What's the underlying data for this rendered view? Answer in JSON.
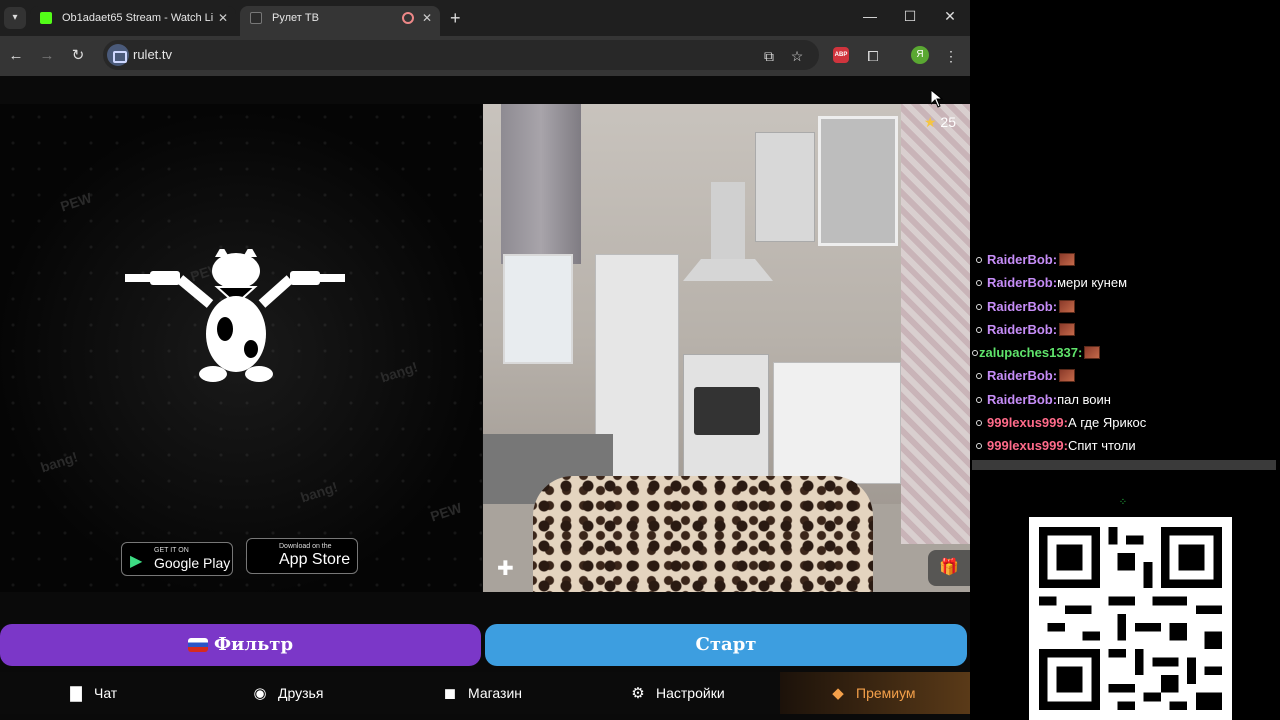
{
  "browser": {
    "tabs": [
      {
        "title": "Ob1adaet65 Stream - Watch Li",
        "favicon_color": "#53fc18"
      },
      {
        "title": "Рулет ТВ",
        "favicon_color": "#2b2b2b"
      }
    ],
    "url": "rulet.tv",
    "profile_initial": "Я",
    "abp_label": "ABP"
  },
  "page": {
    "store_buttons": {
      "google_small": "GET IT ON",
      "google_big": "Google Play",
      "apple_small": "Download on the",
      "apple_big": "App Store"
    },
    "video": {
      "stars": "25"
    },
    "filter_label": "Фильтр",
    "start_label": "Старт",
    "nav": [
      {
        "label": "Чат",
        "icon": "chat-icon"
      },
      {
        "label": "Друзья",
        "icon": "friends-icon"
      },
      {
        "label": "Магазин",
        "icon": "shop-icon"
      },
      {
        "label": "Настройки",
        "icon": "settings-icon"
      },
      {
        "label": "Премиум",
        "icon": "premium-tag-icon"
      }
    ],
    "colors": {
      "filter": "#7b37c8",
      "start": "#3d9ee0",
      "premium_text": "#f4a04a"
    }
  },
  "chat": {
    "messages": [
      {
        "user": "RaiderBob:",
        "text": "",
        "emote": true,
        "color": "#c68df7"
      },
      {
        "user": "RaiderBob:",
        "text": "мери кунем",
        "emote": false,
        "color": "#c68df7"
      },
      {
        "user": "RaiderBob:",
        "text": "",
        "emote": true,
        "color": "#c68df7"
      },
      {
        "user": "RaiderBob:",
        "text": "",
        "emote": true,
        "color": "#c68df7"
      },
      {
        "user": "zalupaches1337:",
        "text": "",
        "emote": true,
        "color": "#5fe36b"
      },
      {
        "user": "RaiderBob:",
        "text": "",
        "emote": true,
        "color": "#c68df7"
      },
      {
        "user": "RaiderBob:",
        "text": "пал воин",
        "emote": false,
        "color": "#c68df7"
      },
      {
        "user": "999lexus999:",
        "text": "А где Ярикос",
        "emote": false,
        "color": "#ff6b8a"
      },
      {
        "user": "999lexus999:",
        "text": "Спит чтоли",
        "emote": false,
        "color": "#ff6b8a"
      }
    ]
  }
}
